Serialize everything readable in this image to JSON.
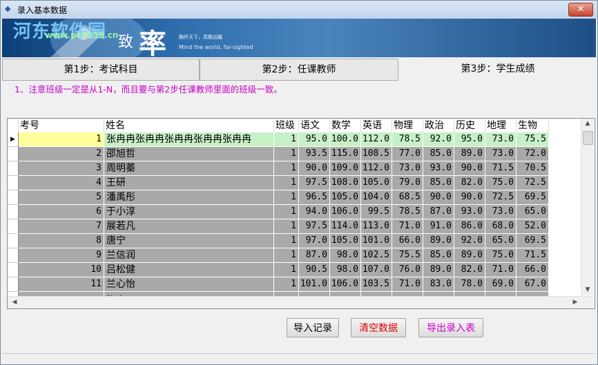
{
  "window": {
    "title": "录入基本数据",
    "close_label": "✕"
  },
  "banner": {
    "watermark_site": "河东软件园",
    "watermark_url": "www.pc0359.cn",
    "brand_zhi": "致",
    "brand_shuai": "率",
    "slogan_cn": "胸怀天下，高瞻远瞩",
    "slogan_en": "Mind the world, far-sighted"
  },
  "tabs": [
    {
      "label": "第1步：考试科目"
    },
    {
      "label": "第2步：任课教师"
    },
    {
      "label": "第3步：学生成绩",
      "active": true
    }
  ],
  "note": "1、注意班级一定是从1-N，而且要与第2步任课教师里面的班级一致。",
  "grid": {
    "headers": [
      "考号",
      "姓名",
      "班级",
      "语文",
      "数学",
      "英语",
      "物理",
      "政治",
      "历史",
      "地理",
      "生物"
    ],
    "current_row_marker": "▶",
    "rows": [
      [
        "1",
        "张冉冉张冉冉张冉冉张冉冉张冉冉",
        "1",
        "95.0",
        "100.0",
        "112.0",
        "78.5",
        "92.0",
        "95.0",
        "73.0",
        "75.5"
      ],
      [
        "2",
        "邵旭哲",
        "1",
        "93.5",
        "115.0",
        "108.5",
        "77.0",
        "85.0",
        "89.0",
        "73.0",
        "72.0"
      ],
      [
        "3",
        "周明蓁",
        "1",
        "90.0",
        "109.0",
        "112.0",
        "73.0",
        "93.0",
        "90.0",
        "71.5",
        "70.5"
      ],
      [
        "4",
        "王研",
        "1",
        "97.5",
        "108.0",
        "105.0",
        "79.0",
        "85.0",
        "82.0",
        "75.0",
        "72.5"
      ],
      [
        "5",
        "潘禹彤",
        "1",
        "96.5",
        "105.0",
        "104.0",
        "68.5",
        "90.0",
        "90.0",
        "72.5",
        "69.5"
      ],
      [
        "6",
        "于小淳",
        "1",
        "94.0",
        "106.0",
        "99.5",
        "78.5",
        "87.0",
        "93.0",
        "73.0",
        "65.0"
      ],
      [
        "7",
        "展若凡",
        "1",
        "97.5",
        "114.0",
        "113.0",
        "71.0",
        "91.0",
        "86.0",
        "68.0",
        "52.0"
      ],
      [
        "8",
        "唐宁",
        "1",
        "97.0",
        "105.0",
        "101.0",
        "66.0",
        "89.0",
        "92.0",
        "65.0",
        "69.5"
      ],
      [
        "9",
        "兰信润",
        "1",
        "87.0",
        "98.0",
        "102.5",
        "75.5",
        "85.0",
        "89.0",
        "75.0",
        "71.5"
      ],
      [
        "10",
        "吕松健",
        "1",
        "90.5",
        "98.0",
        "107.0",
        "76.0",
        "89.0",
        "82.0",
        "71.0",
        "66.0"
      ],
      [
        "11",
        "兰心怡",
        "1",
        "101.0",
        "106.0",
        "103.5",
        "71.0",
        "83.0",
        "78.0",
        "69.0",
        "67.0"
      ]
    ],
    "partial_row_name": "张卓"
  },
  "buttons": {
    "import": "导入记录",
    "clear": "清空数据",
    "export": "导出录入表"
  },
  "colors": {
    "selected_row": "#c6f0c6",
    "selected_id_cell": "#ffff99",
    "row_bg": "#a9a9a9",
    "note_text": "#c800c8",
    "clear_text": "#e00000",
    "export_text": "#d000d0"
  }
}
